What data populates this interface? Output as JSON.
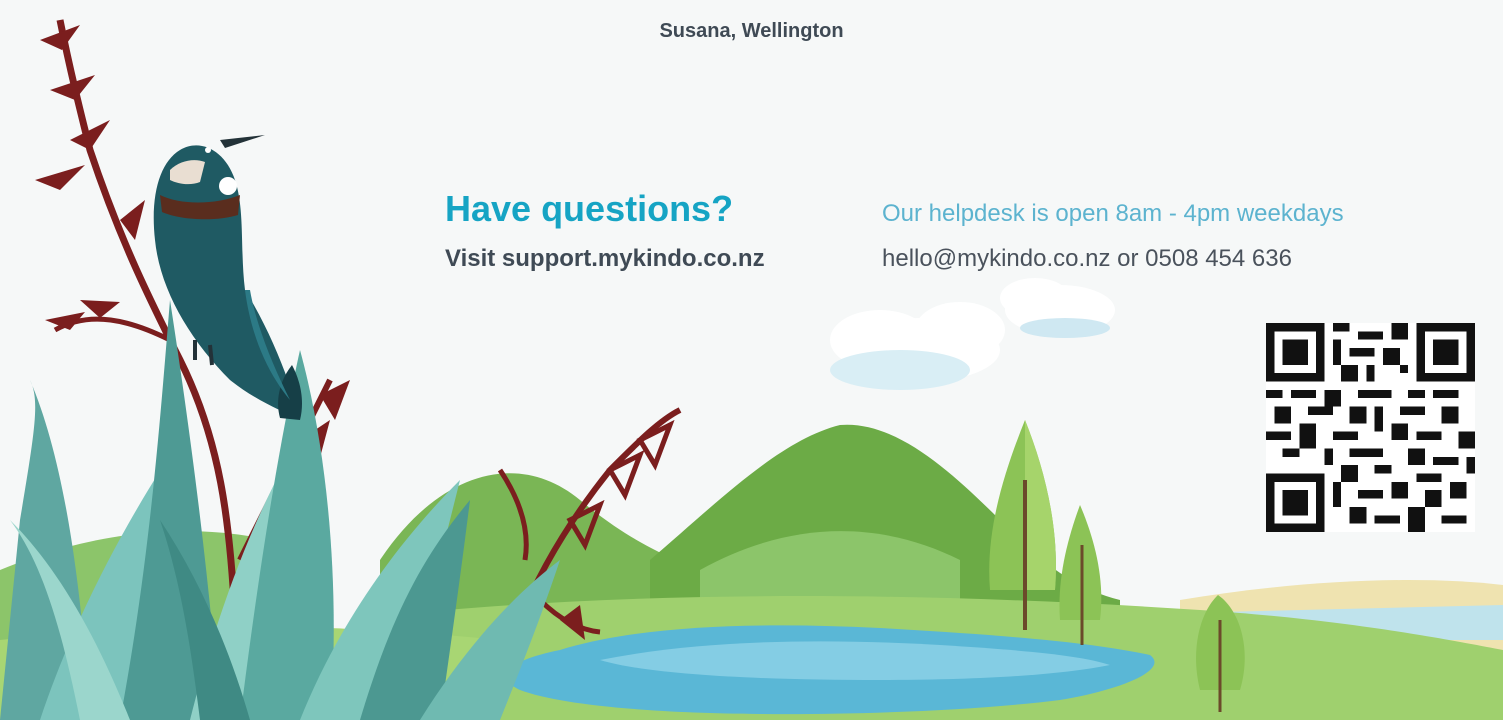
{
  "testimonial_author": "Susana, Wellington",
  "help": {
    "heading": "Have questions?",
    "visit_text": "Visit support.mykindo.co.nz",
    "hours_text": "Our helpdesk is open 8am - 4pm weekdays",
    "contact_text": "hello@mykindo.co.nz or 0508 454 636"
  },
  "colors": {
    "heading": "#16a4c4",
    "hours": "#5cb3cf",
    "body_text": "#3f4a55"
  },
  "icons": {
    "qr_code": "qr-code-icon",
    "bird": "tui-bird-illustration"
  }
}
